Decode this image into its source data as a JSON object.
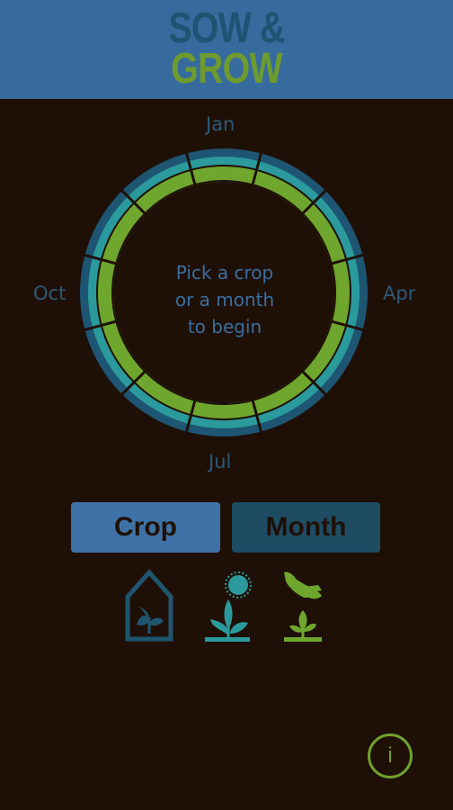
{
  "app": {
    "logo_line1": "SOW &",
    "logo_line2": "GROW"
  },
  "wheel": {
    "month_labels": {
      "top": "Jan",
      "right": "Apr",
      "bottom": "Jul",
      "left": "Oct"
    },
    "center_prompt": [
      "Pick a crop",
      "or a month",
      "to begin"
    ],
    "segments": 12,
    "colors": {
      "outer_ring": "#1e5573",
      "middle_ring": "#2b9a9c",
      "inner_ring": "#6fa62e"
    }
  },
  "toggle": {
    "crop_label": "Crop",
    "month_label": "Month",
    "selected": "Crop"
  },
  "legend_icons": [
    {
      "name": "greenhouse-sprout-icon",
      "color": "#205570"
    },
    {
      "name": "sun-sprout-icon",
      "color": "#2b9a9c"
    },
    {
      "name": "hand-planting-icon",
      "color": "#6fa62e"
    }
  ],
  "info": {
    "label": "i"
  }
}
